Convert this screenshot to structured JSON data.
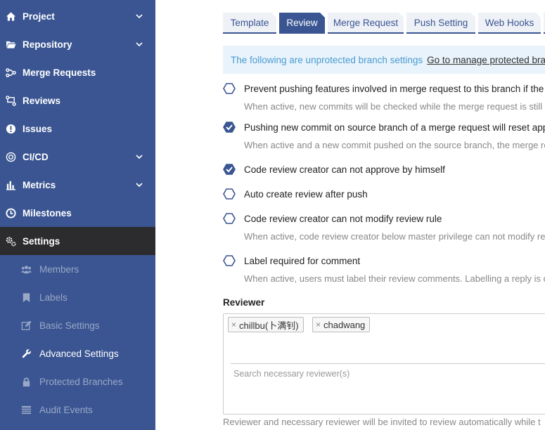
{
  "sidebar": {
    "items": [
      {
        "label": "Project",
        "icon": "home-icon"
      },
      {
        "label": "Repository",
        "icon": "folder-icon"
      },
      {
        "label": "Merge Requests",
        "icon": "merge-icon"
      },
      {
        "label": "Reviews",
        "icon": "review-icon"
      },
      {
        "label": "Issues",
        "icon": "issue-icon"
      },
      {
        "label": "CI/CD",
        "icon": "cicd-icon"
      },
      {
        "label": "Metrics",
        "icon": "bar-chart-icon"
      },
      {
        "label": "Milestones",
        "icon": "clock-icon"
      },
      {
        "label": "Settings",
        "icon": "gear-icon"
      }
    ],
    "sub_items": [
      {
        "label": "Members",
        "icon": "users-icon"
      },
      {
        "label": "Labels",
        "icon": "bookmark-icon"
      },
      {
        "label": "Basic Settings",
        "icon": "edit-icon"
      },
      {
        "label": "Advanced Settings",
        "icon": "wrench-icon"
      },
      {
        "label": "Protected Branches",
        "icon": "lock-icon"
      },
      {
        "label": "Audit Events",
        "icon": "list-icon"
      }
    ],
    "active_item": "Settings",
    "active_sub_item": "Advanced Settings"
  },
  "tabs": [
    {
      "label": "Template"
    },
    {
      "label": "Review"
    },
    {
      "label": "Merge Request"
    },
    {
      "label": "Push Setting"
    },
    {
      "label": "Web Hooks"
    }
  ],
  "active_tab": "Review",
  "info": {
    "text": "The following are unprotected branch settings",
    "link": "Go to manage protected branc"
  },
  "options": [
    {
      "label": "Prevent pushing features involved in merge request to this branch if the m",
      "checked": false,
      "description": "When active, new commits will be checked while the merge request is still"
    },
    {
      "label": "Pushing new commit on source branch of a merge request will reset appro",
      "checked": true,
      "description": "When active and a new commit pushed on the source branch, the merge re"
    },
    {
      "label": "Code review creator can not approve by himself",
      "checked": true,
      "description": ""
    },
    {
      "label": "Auto create review after push",
      "checked": false,
      "description": ""
    },
    {
      "label": "Code review creator can not modify review rule",
      "checked": false,
      "description": "When active, code review creator below master privilege can not modify re"
    },
    {
      "label": "Label required for comment",
      "checked": false,
      "description": "When active, users must label their review comments. Labelling a reply is o"
    }
  ],
  "reviewer": {
    "label": "Reviewer",
    "chips": [
      "chillbu(卜满钊)",
      "chadwang"
    ],
    "search_placeholder": "Search necessary reviewer(s)",
    "footer": "Reviewer and necessary reviewer will be invited to review automatically while t"
  },
  "colors": {
    "sidebar_bg": "#3a5592",
    "active_bg": "#2c2c2e",
    "accent": "#3a5592",
    "info_bg": "#e8f3fb",
    "info_text": "#4a9bd1"
  }
}
